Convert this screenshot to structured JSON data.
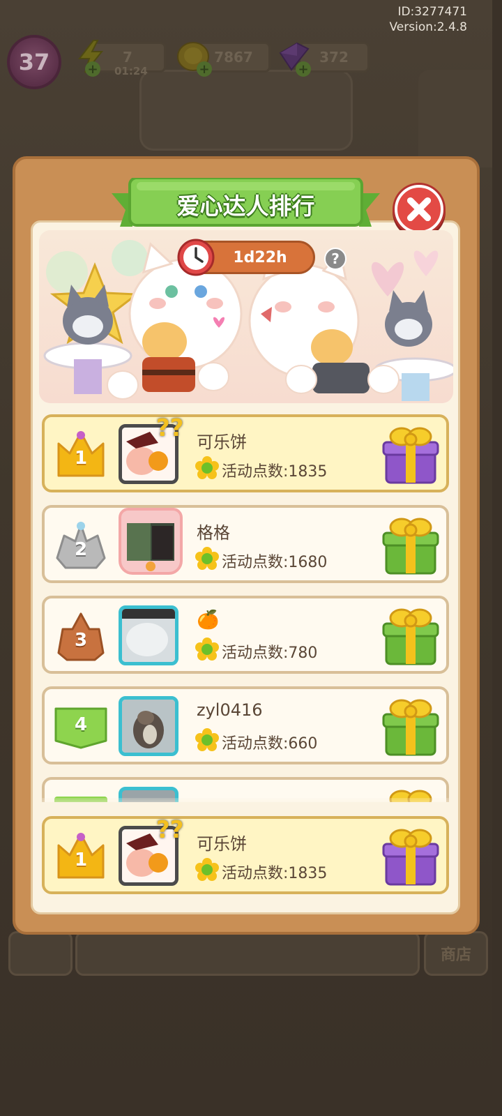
{
  "header": {
    "id_label": "ID:3277471",
    "version_label": "Version:2.4.8"
  },
  "hud": {
    "level": "37",
    "energy": "7",
    "energy_timer": "01:24",
    "coins": "7867",
    "gems": "372",
    "shop_label": "商店"
  },
  "modal": {
    "title": "爱心达人排行",
    "countdown": "1d22h",
    "help_label": "?"
  },
  "score_prefix": "活动点数:",
  "rankings": [
    {
      "rank": "1",
      "name": "可乐饼",
      "score": "活动点数:1835",
      "badge": "gold-crown",
      "gift": "purple"
    },
    {
      "rank": "2",
      "name": "格格",
      "score": "活动点数:1680",
      "badge": "silver-crown",
      "gift": "green"
    },
    {
      "rank": "3",
      "name": "🍊",
      "score": "活动点数:780",
      "badge": "bronze-crown",
      "gift": "green"
    },
    {
      "rank": "4",
      "name": "zyl0416",
      "score": "活动点数:660",
      "badge": "green-tag",
      "gift": "green"
    }
  ],
  "my_rank": {
    "rank": "1",
    "name": "可乐饼",
    "score": "活动点数:1835"
  },
  "colors": {
    "modal_frame": "#c98f55",
    "panel": "#fbf3e2",
    "title_ribbon": "#7cc84a",
    "close": "#e34a45",
    "gold_row": "#fff5c4",
    "timer_pill": "#d8733a"
  }
}
